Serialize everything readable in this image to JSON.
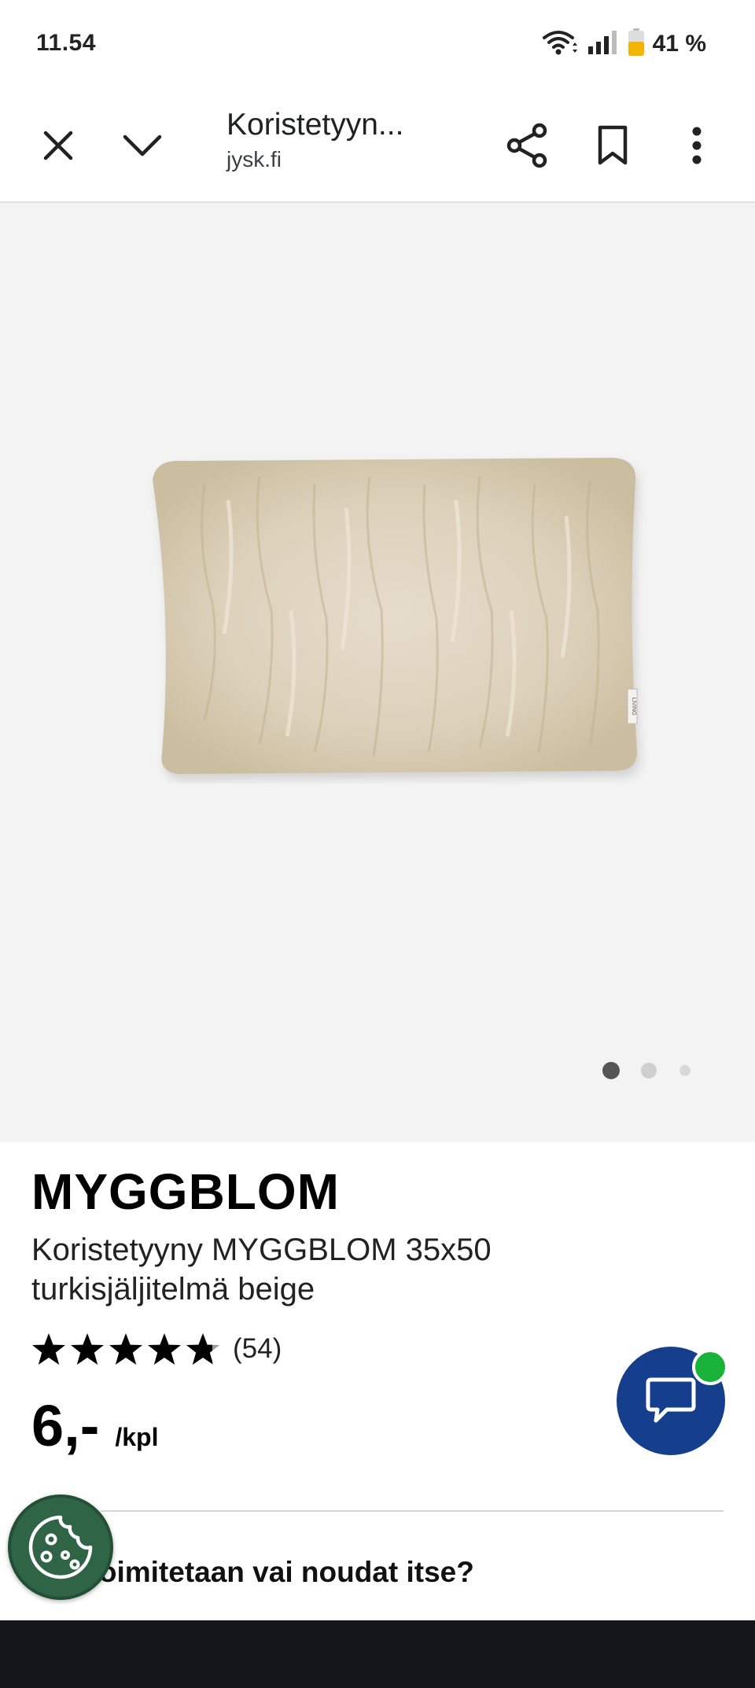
{
  "status_bar": {
    "time": "11.54",
    "battery": "41 %",
    "icons": [
      "wifi-icon",
      "signal-icon",
      "battery-icon"
    ]
  },
  "browser": {
    "page_title": "Koristetyyn...",
    "domain": "jysk.fi",
    "icons": [
      "close-icon",
      "chevron-down-icon",
      "share-icon",
      "bookmark-icon",
      "more-vert-icon"
    ]
  },
  "gallery": {
    "image_label": "LIVING",
    "slides": 3,
    "active_slide": 1
  },
  "product": {
    "brand": "MYGGBLOM",
    "name": "Koristetyyny MYGGBLOM 35x50 turkisjäljitelmä beige",
    "rating_stars": 4.7,
    "rating_count": "(54)",
    "price": "6,-",
    "price_unit": "/kpl"
  },
  "delivery": {
    "question": "Toimitetaan vai noudat itse?"
  },
  "colors": {
    "chat_button": "#153e8d",
    "chat_online": "#19b33a",
    "cookie_button": "#2f6446",
    "gallery_bg": "#f3f3f3",
    "battery_fill": "#f4b400"
  }
}
